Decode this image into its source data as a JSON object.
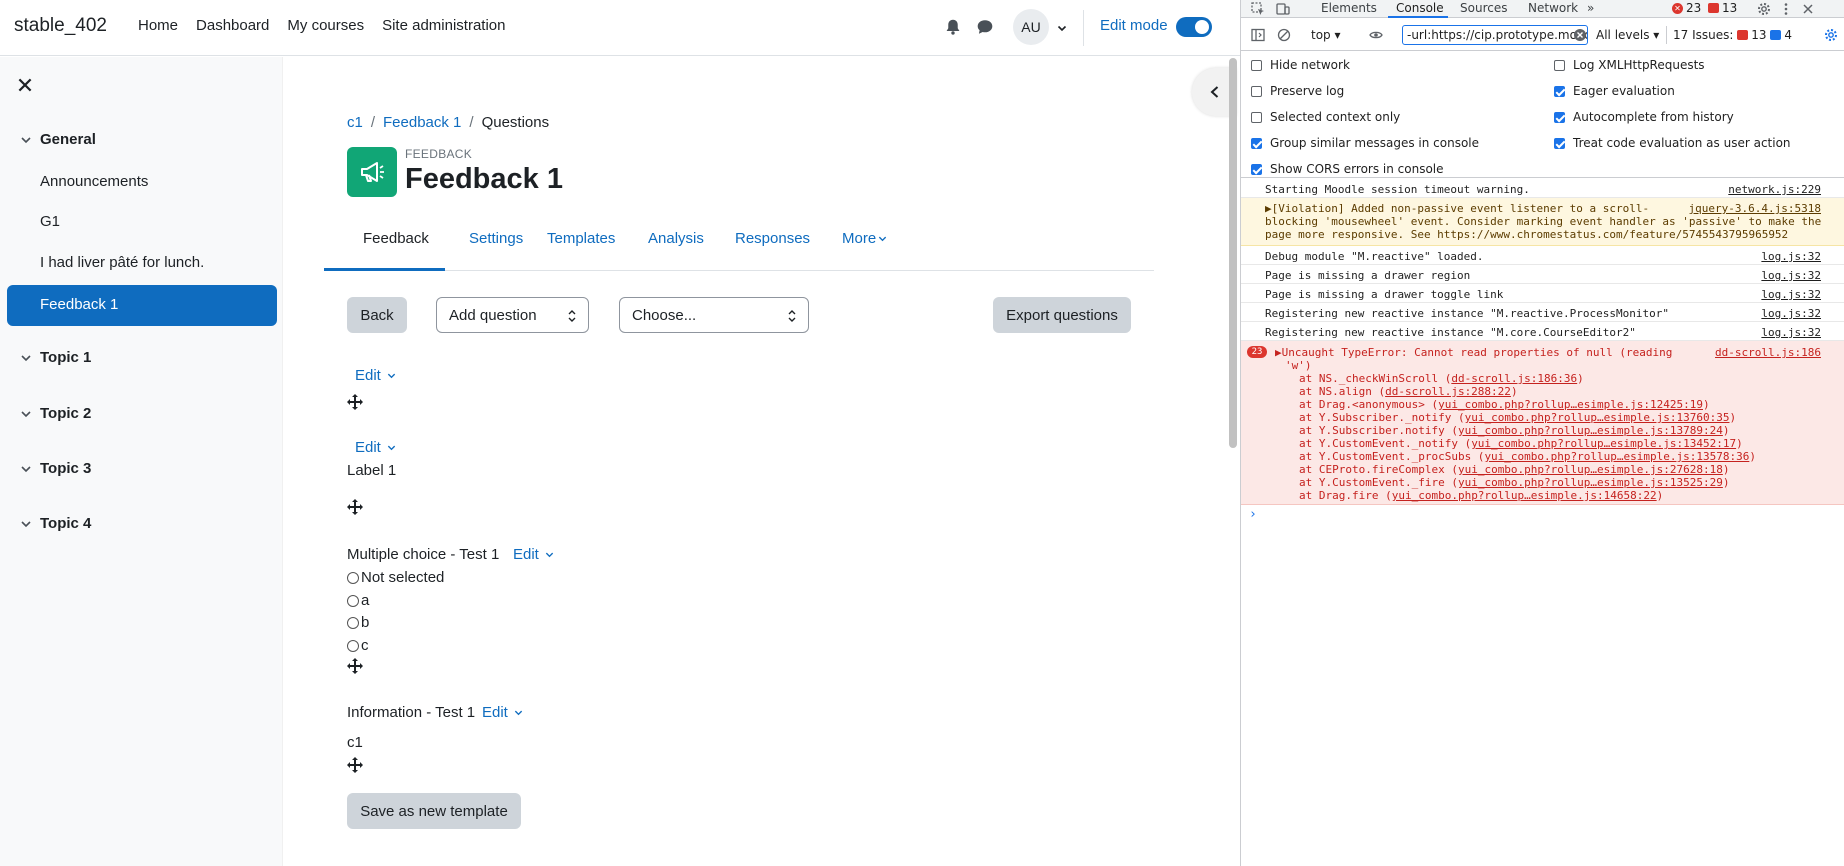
{
  "moodle": {
    "brand": "stable_402",
    "nav": [
      "Home",
      "Dashboard",
      "My courses",
      "Site administration"
    ],
    "user_initials": "AU",
    "edit_mode_label": "Edit mode",
    "drawer": {
      "sections": [
        {
          "title": "General",
          "activities": [
            "Announcements",
            "G1",
            "I had liver pâté for lunch.",
            "Feedback 1"
          ]
        },
        {
          "title": "Topic 1"
        },
        {
          "title": "Topic 2"
        },
        {
          "title": "Topic 3"
        },
        {
          "title": "Topic 4"
        }
      ]
    },
    "breadcrumb": [
      "c1",
      "Feedback 1",
      "Questions"
    ],
    "module_kind": "FEEDBACK",
    "page_title": "Feedback 1",
    "tabs": [
      "Feedback",
      "Settings",
      "Templates",
      "Analysis",
      "Responses",
      "More"
    ],
    "toolbar": {
      "back": "Back",
      "add_question": "Add question",
      "choose": "Choose...",
      "export": "Export questions"
    },
    "edit_label": "Edit",
    "items": {
      "label1": "Label 1",
      "mc_title": "Multiple choice - Test 1",
      "mc_options": [
        "Not selected",
        "a",
        "b",
        "c"
      ],
      "info_title": "Information - Test 1",
      "info_value": "c1"
    },
    "save_template": "Save as new template"
  },
  "devtools": {
    "tabs": [
      "Elements",
      "Console",
      "Sources",
      "Network"
    ],
    "error_count": "23",
    "warning_count": "13",
    "context": "top",
    "filter_value": "-url:https://cip.prototype.moodle",
    "levels": "All levels",
    "issues_label": "17 Issues:",
    "issues_errors": "13",
    "issues_info": "4",
    "settings_left": [
      {
        "label": "Hide network",
        "checked": false
      },
      {
        "label": "Preserve log",
        "checked": false
      },
      {
        "label": "Selected context only",
        "checked": false
      },
      {
        "label": "Group similar messages in console",
        "checked": true
      },
      {
        "label": "Show CORS errors in console",
        "checked": true
      }
    ],
    "settings_right": [
      {
        "label": "Log XMLHttpRequests",
        "checked": false
      },
      {
        "label": "Eager evaluation",
        "checked": true
      },
      {
        "label": "Autocomplete from history",
        "checked": true
      },
      {
        "label": "Treat code evaluation as user action",
        "checked": true
      }
    ],
    "messages": [
      {
        "text": "Starting Moodle session timeout warning.",
        "source": "network.js:229"
      },
      {
        "text_lines": [
          "▶[Violation] Added non-passive event listener to a scroll-",
          "blocking 'mousewheel' event. Consider marking event handler as 'passive' to make the",
          "page more responsive. See https://www.chromestatus.com/feature/5745543795965952"
        ],
        "source": "jquery-3.6.4.js:5318"
      },
      {
        "text": "Debug module \"M.reactive\" loaded.",
        "source": "log.js:32"
      },
      {
        "text": "Page is missing a drawer region",
        "source": "log.js:32"
      },
      {
        "text": "Page is missing a drawer toggle link",
        "source": "log.js:32"
      },
      {
        "text": "Registering new reactive instance \"M.reactive.ProcessMonitor\"",
        "source": "log.js:32"
      },
      {
        "text": "Registering new reactive instance \"M.core.CourseEditor2\"",
        "source": "log.js:32"
      }
    ],
    "error": {
      "count": "23",
      "line1": "▶Uncaught TypeError: Cannot read properties of null (reading",
      "line2": "'w')",
      "source": "dd-scroll.js:186",
      "stack": [
        {
          "pre": "at NS._checkWinScroll (",
          "link": "dd-scroll.js:186:36",
          "post": ")"
        },
        {
          "pre": "at NS.align (",
          "link": "dd-scroll.js:288:22",
          "post": ")"
        },
        {
          "pre": "at Drag.<anonymous> (",
          "link": "yui_combo.php?rollup…esimple.js:12425:19",
          "post": ")"
        },
        {
          "pre": "at Y.Subscriber._notify (",
          "link": "yui_combo.php?rollup…esimple.js:13760:35",
          "post": ")"
        },
        {
          "pre": "at Y.Subscriber.notify (",
          "link": "yui_combo.php?rollup…esimple.js:13789:24",
          "post": ")"
        },
        {
          "pre": "at Y.CustomEvent._notify (",
          "link": "yui_combo.php?rollup…esimple.js:13452:17",
          "post": ")"
        },
        {
          "pre": "at Y.CustomEvent._procSubs (",
          "link": "yui_combo.php?rollup…esimple.js:13578:36",
          "post": ")"
        },
        {
          "pre": "at CEProto.fireComplex (",
          "link": "yui_combo.php?rollup…esimple.js:27628:18",
          "post": ")"
        },
        {
          "pre": "at Y.CustomEvent._fire (",
          "link": "yui_combo.php?rollup…esimple.js:13525:29",
          "post": ")"
        },
        {
          "pre": "at Drag.fire (",
          "link": "yui_combo.php?rollup…esimple.js:14658:22",
          "post": ")"
        }
      ]
    },
    "prompt": "›"
  }
}
